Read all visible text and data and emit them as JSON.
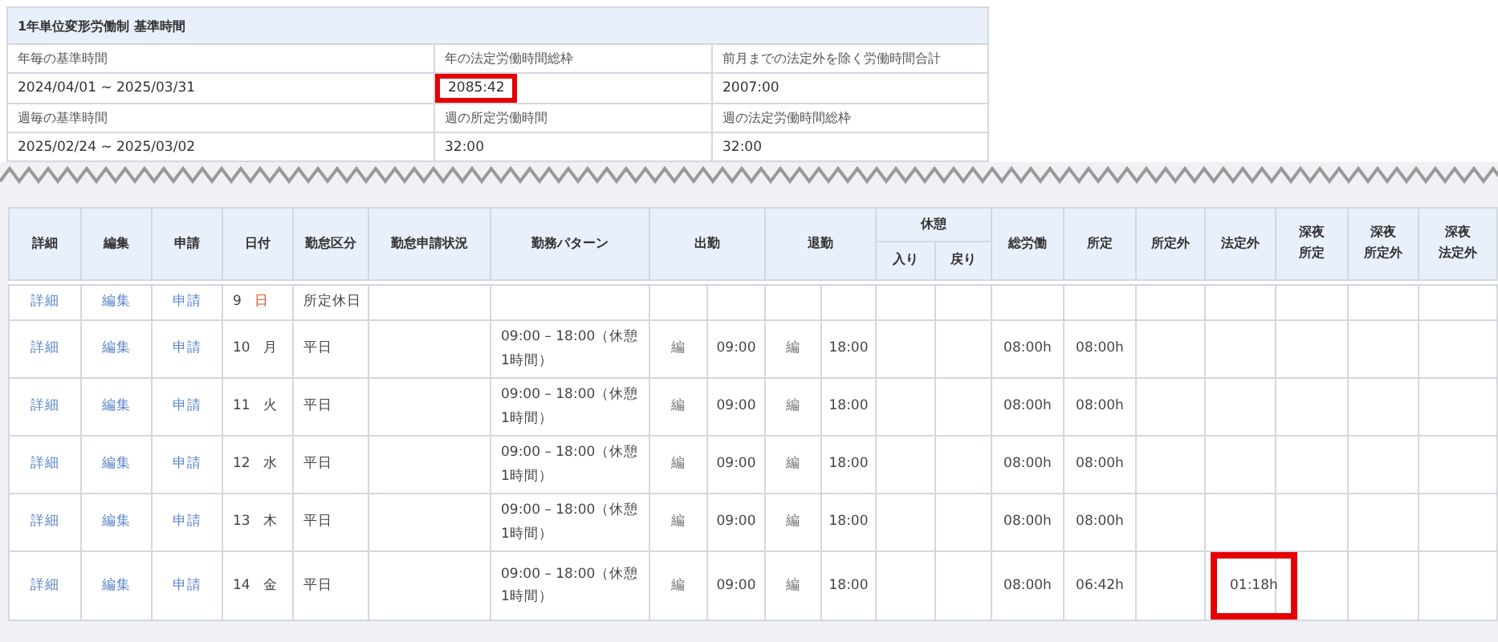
{
  "summary": {
    "title": "1年単位変形労働制 基準時間",
    "rows": [
      {
        "kind": "label",
        "cells": [
          {
            "text": "年毎の基準時間",
            "highlighted": false
          },
          {
            "text": "年の法定労働時間総枠",
            "highlighted": false
          },
          {
            "text": "前月までの法定外を除く労働時間合計",
            "highlighted": false
          }
        ]
      },
      {
        "kind": "value",
        "cells": [
          {
            "text": "2024/04/01 ~ 2025/03/31",
            "highlighted": false
          },
          {
            "text": "2085:42",
            "highlighted": true
          },
          {
            "text": "2007:00",
            "highlighted": false
          }
        ]
      },
      {
        "kind": "label",
        "cells": [
          {
            "text": "週毎の基準時間",
            "highlighted": false
          },
          {
            "text": "週の所定労働時間",
            "highlighted": false
          },
          {
            "text": "週の法定労働時間総枠",
            "highlighted": false
          }
        ]
      },
      {
        "kind": "value",
        "cells": [
          {
            "text": "2025/02/24 ~ 2025/03/02",
            "highlighted": false
          },
          {
            "text": "32:00",
            "highlighted": false
          },
          {
            "text": "32:00",
            "highlighted": false
          }
        ]
      }
    ]
  },
  "table": {
    "columns": [
      {
        "kind": "plain",
        "lines": [
          "詳細"
        ]
      },
      {
        "kind": "plain",
        "lines": [
          "編集"
        ]
      },
      {
        "kind": "plain",
        "lines": [
          "申請"
        ]
      },
      {
        "kind": "plain",
        "lines": [
          "日付"
        ]
      },
      {
        "kind": "plain",
        "lines": [
          "勤怠区分"
        ]
      },
      {
        "kind": "plain",
        "lines": [
          "勤怠申請状況"
        ]
      },
      {
        "kind": "plain",
        "lines": [
          "勤務パターン"
        ]
      },
      {
        "kind": "pair",
        "lines": [
          "出勤"
        ]
      },
      {
        "kind": "pair",
        "lines": [
          "退勤"
        ]
      },
      {
        "kind": "group",
        "lines": [
          "休憩"
        ],
        "children": [
          "入り",
          "戻り"
        ]
      },
      {
        "kind": "plain",
        "lines": [
          "総労働"
        ]
      },
      {
        "kind": "plain",
        "lines": [
          "所定"
        ]
      },
      {
        "kind": "plain",
        "lines": [
          "所定外"
        ]
      },
      {
        "kind": "plain",
        "lines": [
          "法定外"
        ]
      },
      {
        "kind": "plain",
        "lines": [
          "深夜",
          "所定"
        ]
      },
      {
        "kind": "plain",
        "lines": [
          "深夜",
          "所定外"
        ]
      },
      {
        "kind": "plain",
        "lines": [
          "深夜",
          "法定外"
        ]
      }
    ],
    "rows": [
      {
        "links": [
          "詳細",
          "編集",
          "申請"
        ],
        "day": "9",
        "weekday": "日",
        "holiday": true,
        "category": "所定休日",
        "overtime_highlighted": false
      },
      {
        "links": [
          "詳細",
          "編集",
          "申請"
        ],
        "day": "10",
        "weekday": "月",
        "holiday": false,
        "category": "平日",
        "pattern": "09:00 – 18:00（休憩1時間）",
        "in_mark": "編",
        "in_time": "09:00",
        "out_mark": "編",
        "out_time": "18:00",
        "total": "08:00h",
        "scheduled": "08:00h",
        "overtime_highlighted": false
      },
      {
        "links": [
          "詳細",
          "編集",
          "申請"
        ],
        "day": "11",
        "weekday": "火",
        "holiday": false,
        "category": "平日",
        "pattern": "09:00 – 18:00（休憩1時間）",
        "in_mark": "編",
        "in_time": "09:00",
        "out_mark": "編",
        "out_time": "18:00",
        "total": "08:00h",
        "scheduled": "08:00h",
        "overtime_highlighted": false
      },
      {
        "links": [
          "詳細",
          "編集",
          "申請"
        ],
        "day": "12",
        "weekday": "水",
        "holiday": false,
        "category": "平日",
        "pattern": "09:00 – 18:00（休憩1時間）",
        "in_mark": "編",
        "in_time": "09:00",
        "out_mark": "編",
        "out_time": "18:00",
        "total": "08:00h",
        "scheduled": "08:00h",
        "overtime_highlighted": false
      },
      {
        "links": [
          "詳細",
          "編集",
          "申請"
        ],
        "day": "13",
        "weekday": "木",
        "holiday": false,
        "category": "平日",
        "pattern": "09:00 – 18:00（休憩1時間）",
        "in_mark": "編",
        "in_time": "09:00",
        "out_mark": "編",
        "out_time": "18:00",
        "total": "08:00h",
        "scheduled": "08:00h",
        "overtime_highlighted": false
      },
      {
        "links": [
          "詳細",
          "編集",
          "申請"
        ],
        "day": "14",
        "weekday": "金",
        "holiday": false,
        "category": "平日",
        "pattern": "09:00 – 18:00（休憩1時間）",
        "in_mark": "編",
        "in_time": "09:00",
        "out_mark": "編",
        "out_time": "18:00",
        "total": "08:00h",
        "scheduled": "06:42h",
        "legal_overtime": "01:18h",
        "overtime_highlighted": true
      }
    ]
  }
}
